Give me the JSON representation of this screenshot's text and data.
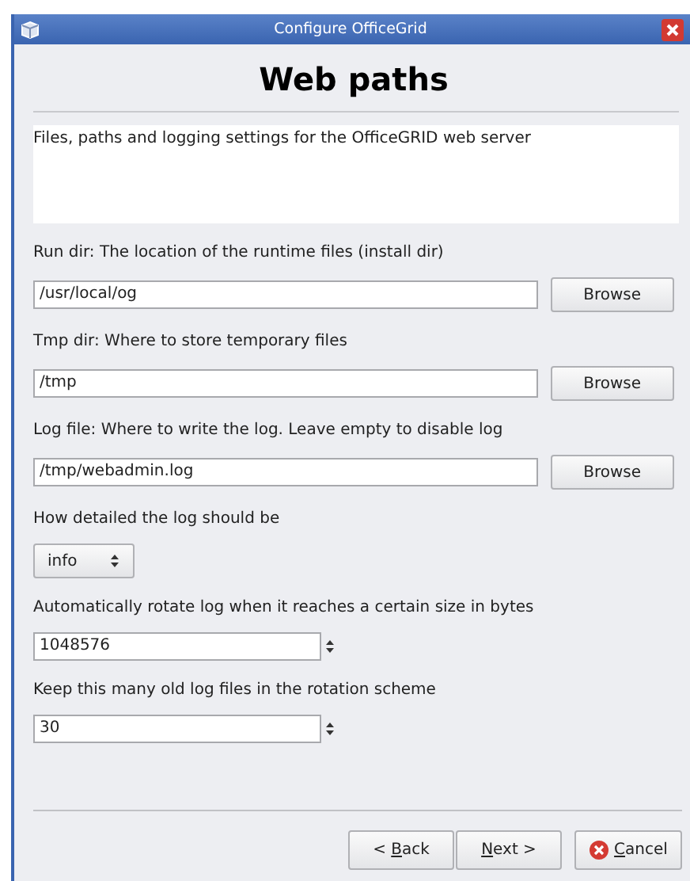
{
  "window": {
    "title": "Configure OfficeGrid"
  },
  "heading": "Web paths",
  "description": "Files, paths and logging settings for the OfficeGRID web server",
  "fields": [
    {
      "kind": "path",
      "label": "Run dir: The location of the runtime files (install dir)",
      "value": "/usr/local/og",
      "button": "Browse"
    },
    {
      "kind": "path",
      "label": "Tmp dir: Where to store temporary files",
      "value": "/tmp",
      "button": "Browse"
    },
    {
      "kind": "path",
      "label": "Log file: Where to write the log. Leave empty to disable log",
      "value": "/tmp/webadmin.log",
      "button": "Browse"
    },
    {
      "kind": "select",
      "label": "How detailed the log should be",
      "value": "info"
    },
    {
      "kind": "spin",
      "label": "Automatically rotate log when it reaches a certain size in bytes",
      "value": "1048576"
    },
    {
      "kind": "spin",
      "label": "Keep this many old log files in the rotation scheme",
      "value": "30"
    }
  ],
  "buttons": [
    {
      "kind": "nav",
      "pre": "< ",
      "key": "B",
      "post": "ack"
    },
    {
      "kind": "nav",
      "key": "N",
      "post": "ext >"
    },
    {
      "kind": "cancel",
      "key": "C",
      "post": "ancel"
    }
  ]
}
